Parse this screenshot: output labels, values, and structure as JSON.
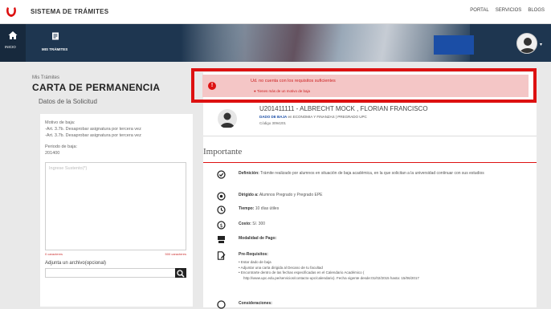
{
  "topbar": {
    "app_title": "SISTEMA DE TRÁMITES",
    "links": [
      "PORTAL",
      "SERVICIOS",
      "BLOGS"
    ]
  },
  "nav": {
    "home_label": "INICIO",
    "tramites_label": "MIS TRÁMITES"
  },
  "left": {
    "breadcrumb": "Mis Trámites",
    "title": "CARTA DE PERMANENCIA",
    "section": "Datos de la Solicitud",
    "motivo_label": "Motivo de baja:",
    "motivo_values": [
      "-Art. 3.7b. Desaprobar asignatura por tercera vez",
      "-Art. 3.7b. Desaprobar asignatura por tercera vez"
    ],
    "periodo_label": "Periodo de baja:",
    "periodo_value": "201400",
    "textarea_placeholder": "Ingrese Sustento(*)",
    "counter_left": "0 caracteres",
    "counter_right": "500 caracteres",
    "attach_label": "Adjunta un archivo(opcional)"
  },
  "alert": {
    "title": "Ud. no cuenta con los requisitos suficientes",
    "item": "● Tienes más de un motivo de baja"
  },
  "student": {
    "name": "U201411111 - ALBRECHT MOCK , FLORIAN FRANCISCO",
    "sub_bold": "DADO DE BAJA",
    "sub_rest": " en ECONOMIA Y FINANZAS | PREGRADO UPC",
    "code": "Código 3094201"
  },
  "importante": {
    "title": "Importante",
    "definicion_label": "Definición:",
    "definicion_text": " Trámite realizado por alumnos en situación de baja académica, en la que solicitan a la universidad continuar con sus estudios",
    "dirigido_label": "Dirigido a:",
    "dirigido_text": " Alumnos Pregrado y Pregrado EPE",
    "tiempo_label": "Tiempo:",
    "tiempo_text": " 10 días útiles",
    "costo_label": "Costo:",
    "costo_text": " S/. 300",
    "modalidad_label": "Modalidad de Pago:",
    "prereq_label": "Pre-Requisitos:",
    "prereq_items": [
      "• Estar dado de baja",
      "• Adjuntar una carta dirigida al Decano de tu facultad",
      "• Encontrarte dentro de las fechas especificadas en el Calendario Académico (",
      "  http://www.upc.edu.pe/servicios/contacto-upc/calendario). Fecha vigente desde:01/02/2015 hasta: 15/06/2017"
    ],
    "consideraciones_label": "Consideraciones:"
  }
}
